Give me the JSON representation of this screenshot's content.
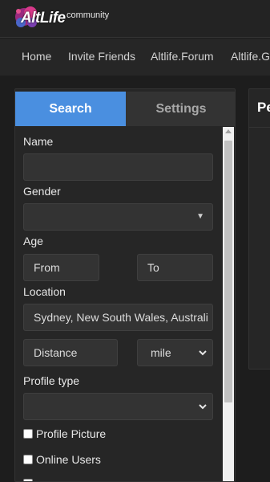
{
  "brand": {
    "name": "AltLife",
    "suffix": "community"
  },
  "nav": {
    "items": [
      "Home",
      "Invite Friends",
      "Altlife.Forum",
      "Altlife.G"
    ]
  },
  "tabs": {
    "search": "Search",
    "settings": "Settings"
  },
  "form": {
    "name_label": "Name",
    "name_value": "",
    "gender_label": "Gender",
    "gender_value": "",
    "age_label": "Age",
    "age_from": "From",
    "age_to": "To",
    "location_label": "Location",
    "location_value": "Sydney, New South Wales, Australi",
    "distance_placeholder": "Distance",
    "unit_value": "mile",
    "profile_type_label": "Profile type",
    "profile_type_value": "",
    "checkbox_profile_picture": "Profile Picture",
    "checkbox_online_users": "Online Users"
  },
  "right_card": {
    "title": "Pe"
  },
  "colors": {
    "accent": "#4a8fe0",
    "background": "#1d1d1d",
    "panel": "#262626"
  }
}
